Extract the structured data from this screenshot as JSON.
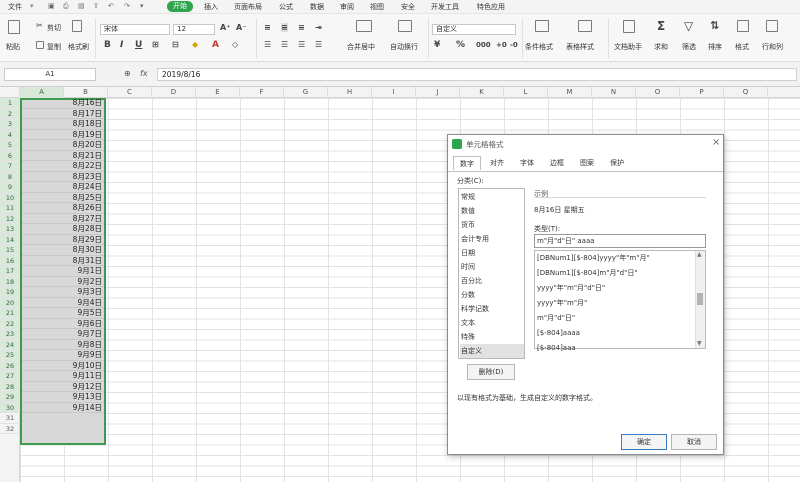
{
  "menu": {
    "file": "文件",
    "tabs": [
      "开始",
      "插入",
      "页面布局",
      "公式",
      "数据",
      "审阅",
      "视图",
      "安全",
      "开发工具",
      "特色应用"
    ],
    "active_tab": "开始"
  },
  "ribbon": {
    "paste": "粘贴",
    "cut": "剪切",
    "copy": "复制",
    "format_painter": "格式刷",
    "font_name": "宋体",
    "font_size": "12",
    "bold": "B",
    "italic": "I",
    "underline": "U",
    "merge_center": "合并居中",
    "wrap_text": "自动换行",
    "number_format": "自定义",
    "currency": "¥",
    "percent": "%",
    "conditional_format": "条件格式",
    "table_style": "表格样式",
    "doc_helper": "文档助手",
    "sum": "求和",
    "filter": "筛选",
    "sort": "排序",
    "format": "格式",
    "row_col": "行和列"
  },
  "formula_bar": {
    "name_box": "A1",
    "fx": "fx",
    "value": "2019/8/16"
  },
  "columns": [
    "A",
    "B",
    "C",
    "D",
    "E",
    "F",
    "G",
    "H",
    "I",
    "J",
    "K",
    "L",
    "M",
    "N",
    "O",
    "P",
    "Q"
  ],
  "rows": [
    "1",
    "2",
    "3",
    "4",
    "5",
    "6",
    "7",
    "8",
    "9",
    "10",
    "11",
    "12",
    "13",
    "14",
    "15",
    "16",
    "17",
    "18",
    "19",
    "20",
    "21",
    "22",
    "23",
    "24",
    "25",
    "26",
    "27",
    "28",
    "29",
    "30",
    "31",
    "32"
  ],
  "colA_values": [
    "8月16日",
    "8月17日",
    "8月18日",
    "8月19日",
    "8月20日",
    "8月21日",
    "8月22日",
    "8月23日",
    "8月24日",
    "8月25日",
    "8月26日",
    "8月27日",
    "8月28日",
    "8月29日",
    "8月30日",
    "8月31日",
    "9月1日",
    "9月2日",
    "9月3日",
    "9月4日",
    "9月5日",
    "9月6日",
    "9月7日",
    "9月8日",
    "9月9日",
    "9月10日",
    "9月11日",
    "9月12日",
    "9月13日",
    "9月14日"
  ],
  "dialog": {
    "title": "单元格格式",
    "tabs": [
      "数字",
      "对齐",
      "字体",
      "边框",
      "图案",
      "保护"
    ],
    "category_label": "分类(C):",
    "categories": [
      "常规",
      "数值",
      "货币",
      "会计专用",
      "日期",
      "时间",
      "百分比",
      "分数",
      "科学记数",
      "文本",
      "特殊",
      "自定义"
    ],
    "selected_category": "自定义",
    "sample_label": "示例",
    "sample_value": "8月16日 星期五",
    "type_label": "类型(T):",
    "type_value": "m\"月\"d\"日\" aaaa",
    "formats": [
      "[DBNum1][$-804]yyyy\"年\"m\"月\"",
      "[DBNum1][$-804]m\"月\"d\"日\"",
      "yyyy\"年\"m\"月\"d\"日\"",
      "yyyy\"年\"m\"月\"",
      "m\"月\"d\"日\"",
      "[$-804]aaaa",
      "[$-804]aaa"
    ],
    "delete_button": "删除(D)",
    "hint": "以现有格式为基础，生成自定义的数字格式。",
    "ok": "确定",
    "cancel": "取消"
  },
  "colors": {
    "accent": "#2ea44f",
    "selection_border": "#3d9a4e"
  }
}
